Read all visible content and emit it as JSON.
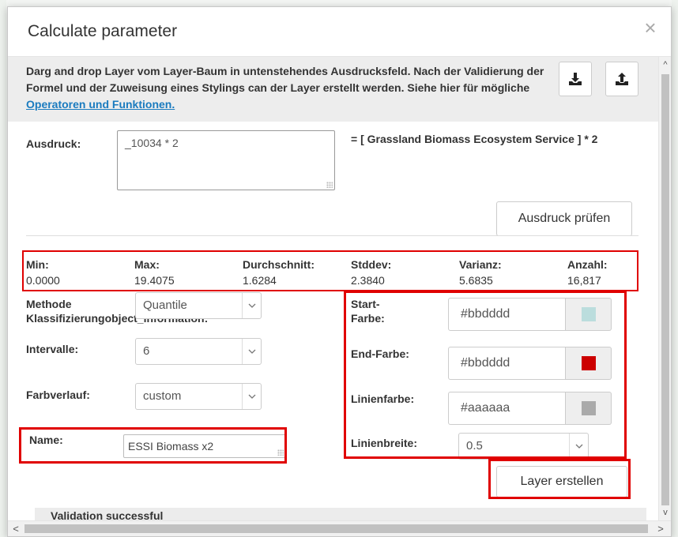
{
  "dialog": {
    "title": "Calculate parameter",
    "close_label": "×"
  },
  "info": {
    "text": "Darg and drop Layer vom Layer-Baum in untenstehendes Ausdrucksfeld. Nach der Validierung der Formel und der Zuweisung eines Stylings can der Layer erstellt werden. Siehe hier für mögliche ",
    "link": "Operatoren und Funktionen.",
    "download_icon": "download-icon",
    "upload_icon": "upload-icon"
  },
  "expression": {
    "label": "Ausdruck:",
    "value": "_10034 * 2",
    "result_text": "= [ Grassland Biomass Ecosystem Service ] * 2",
    "validate_button": "Ausdruck prüfen"
  },
  "stats": [
    {
      "label": "Min:",
      "value": "0.0000"
    },
    {
      "label": "Max:",
      "value": "19.4075"
    },
    {
      "label": "Durchschnitt:",
      "value": "1.6284"
    },
    {
      "label": "Stddev:",
      "value": "2.3840"
    },
    {
      "label": "Varianz:",
      "value": "5.6835"
    },
    {
      "label": "Anzahl:",
      "value": "16,817"
    }
  ],
  "form": {
    "method_label_line1": "Methode",
    "method_label_line2": "Klassifizierungobject_information:",
    "method_value": "Quantile",
    "intervals_label": "Intervalle:",
    "intervals_value": "6",
    "gradient_label": "Farbverlauf:",
    "gradient_value": "custom",
    "name_label": "Name:",
    "name_value": "ESSI Biomass x2",
    "start_color_label_line1": "Start-",
    "start_color_label_line2": "Farbe:",
    "start_color_value": "#bbdddd",
    "end_color_label": "End-Farbe:",
    "end_color_value": "#bbdddd",
    "line_color_label": "Linienfarbe:",
    "line_color_value": "#aaaaaa",
    "line_width_label": "Linienbreite:",
    "line_width_value": "0.5",
    "create_button": "Layer erstellen"
  },
  "swatch_colors": {
    "start": "#bbdddd",
    "end": "#cc0000",
    "line": "#aaaaaa"
  },
  "status": {
    "text": "Validation successful"
  }
}
